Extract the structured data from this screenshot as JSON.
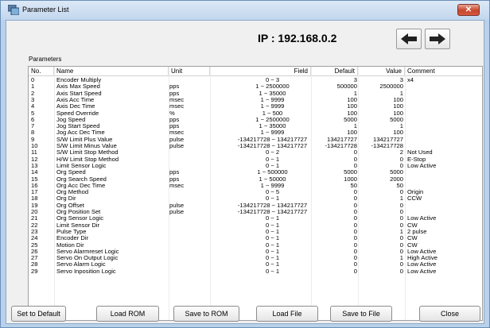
{
  "window": {
    "title": "Parameter List",
    "close_label": "✕"
  },
  "ip": "IP : 192.168.0.2",
  "nav": {
    "back_icon": "arrow-left-icon",
    "forward_icon": "arrow-right-icon"
  },
  "group_label": "Parameters",
  "columns": [
    "No.",
    "Name",
    "Unit",
    "Field",
    "Default",
    "Value",
    "Comment"
  ],
  "rows": [
    {
      "no": "0",
      "name": "Encoder Multiply",
      "unit": "",
      "field": "0 ~ 3",
      "default": "3",
      "value": "3",
      "comment": "x4"
    },
    {
      "no": "1",
      "name": "Axis Max Speed",
      "unit": "pps",
      "field": "1 ~ 2500000",
      "default": "500000",
      "value": "2500000",
      "comment": ""
    },
    {
      "no": "2",
      "name": "Axis Start Speed",
      "unit": "pps",
      "field": "1 ~ 35000",
      "default": "1",
      "value": "1",
      "comment": ""
    },
    {
      "no": "3",
      "name": "Axis Acc Time",
      "unit": "msec",
      "field": "1 ~ 9999",
      "default": "100",
      "value": "100",
      "comment": ""
    },
    {
      "no": "4",
      "name": "Axis Dec Time",
      "unit": "msec",
      "field": "1 ~ 9999",
      "default": "100",
      "value": "100",
      "comment": ""
    },
    {
      "no": "5",
      "name": "Speed Override",
      "unit": "%",
      "field": "1 ~ 500",
      "default": "100",
      "value": "100",
      "comment": ""
    },
    {
      "no": "6",
      "name": "Jog Speed",
      "unit": "pps",
      "field": "1 ~ 2500000",
      "default": "5000",
      "value": "5000",
      "comment": ""
    },
    {
      "no": "7",
      "name": "Jog Start Speed",
      "unit": "pps",
      "field": "1 ~ 35000",
      "default": "1",
      "value": "1",
      "comment": ""
    },
    {
      "no": "8",
      "name": "Jog Acc Dec Time",
      "unit": "msec",
      "field": "1 ~ 9999",
      "default": "100",
      "value": "100",
      "comment": ""
    },
    {
      "no": "9",
      "name": "S/W Limit Plus Value",
      "unit": "pulse",
      "field": "-134217728 ~ 134217727",
      "default": "134217727",
      "value": "134217727",
      "comment": ""
    },
    {
      "no": "10",
      "name": "S/W Limit Minus Value",
      "unit": "pulse",
      "field": "-134217728 ~ 134217727",
      "default": "-134217728",
      "value": "-134217728",
      "comment": ""
    },
    {
      "no": "11",
      "name": "S/W Limit Stop Method",
      "unit": "",
      "field": "0 ~ 2",
      "default": "0",
      "value": "2",
      "comment": "Not Used"
    },
    {
      "no": "12",
      "name": "H/W Limit Stop Method",
      "unit": "",
      "field": "0 ~ 1",
      "default": "0",
      "value": "0",
      "comment": "E-Stop"
    },
    {
      "no": "13",
      "name": "Limit Sensor Logic",
      "unit": "",
      "field": "0 ~ 1",
      "default": "0",
      "value": "0",
      "comment": "Low Active"
    },
    {
      "no": "14",
      "name": "Org Speed",
      "unit": "pps",
      "field": "1 ~ 500000",
      "default": "5000",
      "value": "5000",
      "comment": ""
    },
    {
      "no": "15",
      "name": "Org Search Speed",
      "unit": "pps",
      "field": "1 ~ 50000",
      "default": "1000",
      "value": "2000",
      "comment": ""
    },
    {
      "no": "16",
      "name": "Org Acc Dec Time",
      "unit": "msec",
      "field": "1 ~ 9999",
      "default": "50",
      "value": "50",
      "comment": ""
    },
    {
      "no": "17",
      "name": "Org Method",
      "unit": "",
      "field": "0 ~ 5",
      "default": "0",
      "value": "0",
      "comment": "Origin"
    },
    {
      "no": "18",
      "name": "Org Dir",
      "unit": "",
      "field": "0 ~ 1",
      "default": "0",
      "value": "1",
      "comment": "CCW"
    },
    {
      "no": "19",
      "name": "Org Offset",
      "unit": "pulse",
      "field": "-134217728 ~ 134217727",
      "default": "0",
      "value": "0",
      "comment": ""
    },
    {
      "no": "20",
      "name": "Org Position Set",
      "unit": "pulse",
      "field": "-134217728 ~ 134217727",
      "default": "0",
      "value": "0",
      "comment": ""
    },
    {
      "no": "21",
      "name": "Org Sensor Logic",
      "unit": "",
      "field": "0 ~ 1",
      "default": "0",
      "value": "0",
      "comment": "Low Active"
    },
    {
      "no": "22",
      "name": "Limit Sensor Dir",
      "unit": "",
      "field": "0 ~ 1",
      "default": "0",
      "value": "0",
      "comment": "CW"
    },
    {
      "no": "23",
      "name": "Pulse Type",
      "unit": "",
      "field": "0 ~ 1",
      "default": "0",
      "value": "1",
      "comment": "2 pulse"
    },
    {
      "no": "24",
      "name": "Encoder Dir",
      "unit": "",
      "field": "0 ~ 1",
      "default": "0",
      "value": "0",
      "comment": "CW"
    },
    {
      "no": "25",
      "name": "Motion Dir",
      "unit": "",
      "field": "0 ~ 1",
      "default": "0",
      "value": "0",
      "comment": "CW"
    },
    {
      "no": "26",
      "name": "Servo Alarmreset Logic",
      "unit": "",
      "field": "0 ~ 1",
      "default": "0",
      "value": "0",
      "comment": "Low Active"
    },
    {
      "no": "27",
      "name": "Servo On Output Logic",
      "unit": "",
      "field": "0 ~ 1",
      "default": "0",
      "value": "1",
      "comment": "High Active"
    },
    {
      "no": "28",
      "name": "Servo Alarm Logic",
      "unit": "",
      "field": "0 ~ 1",
      "default": "0",
      "value": "0",
      "comment": "Low Active"
    },
    {
      "no": "29",
      "name": "Servo Inposition Logic",
      "unit": "",
      "field": "0 ~ 1",
      "default": "0",
      "value": "0",
      "comment": "Low Active"
    }
  ],
  "buttons": {
    "set_default": "Set to Default",
    "load_rom": "Load ROM",
    "save_rom": "Save to ROM",
    "load_file": "Load File",
    "save_file": "Save to File",
    "close": "Close"
  },
  "colors": {
    "titlebar": "#c8daef",
    "close": "#c8452c",
    "background": "#f0f0f0"
  }
}
